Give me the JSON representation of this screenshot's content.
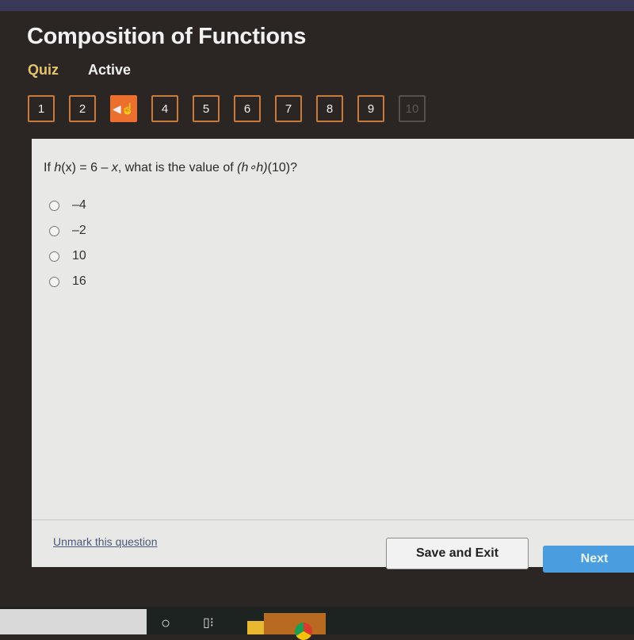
{
  "header": {
    "title": "Composition of Functions",
    "type_label": "Quiz",
    "status_label": "Active"
  },
  "nav": {
    "questions": [
      {
        "label": "1",
        "state": "answered"
      },
      {
        "label": "2",
        "state": "answered"
      },
      {
        "label": "3",
        "state": "current",
        "icon": "flag-arrow-icon"
      },
      {
        "label": "4",
        "state": "answered"
      },
      {
        "label": "5",
        "state": "answered"
      },
      {
        "label": "6",
        "state": "answered"
      },
      {
        "label": "7",
        "state": "answered"
      },
      {
        "label": "8",
        "state": "answered"
      },
      {
        "label": "9",
        "state": "answered"
      },
      {
        "label": "10",
        "state": "disabled"
      }
    ]
  },
  "question": {
    "prefix": "If ",
    "func": "h",
    "def": "(x) = 6 – ",
    "var": "x",
    "middle": ", what is the value of ",
    "composition": "(h∘h)",
    "arg": "(10)?",
    "options": [
      {
        "label": "–4",
        "selected": false
      },
      {
        "label": "–2",
        "selected": false
      },
      {
        "label": "10",
        "selected": false
      },
      {
        "label": "16",
        "selected": false
      }
    ]
  },
  "footer": {
    "unmark_label": "Unmark this question",
    "save_label": "Save and Exit",
    "next_label": "Next"
  },
  "colors": {
    "accent": "#ec6f2d",
    "next_button": "#4a9ee0",
    "background": "#2b2623"
  }
}
